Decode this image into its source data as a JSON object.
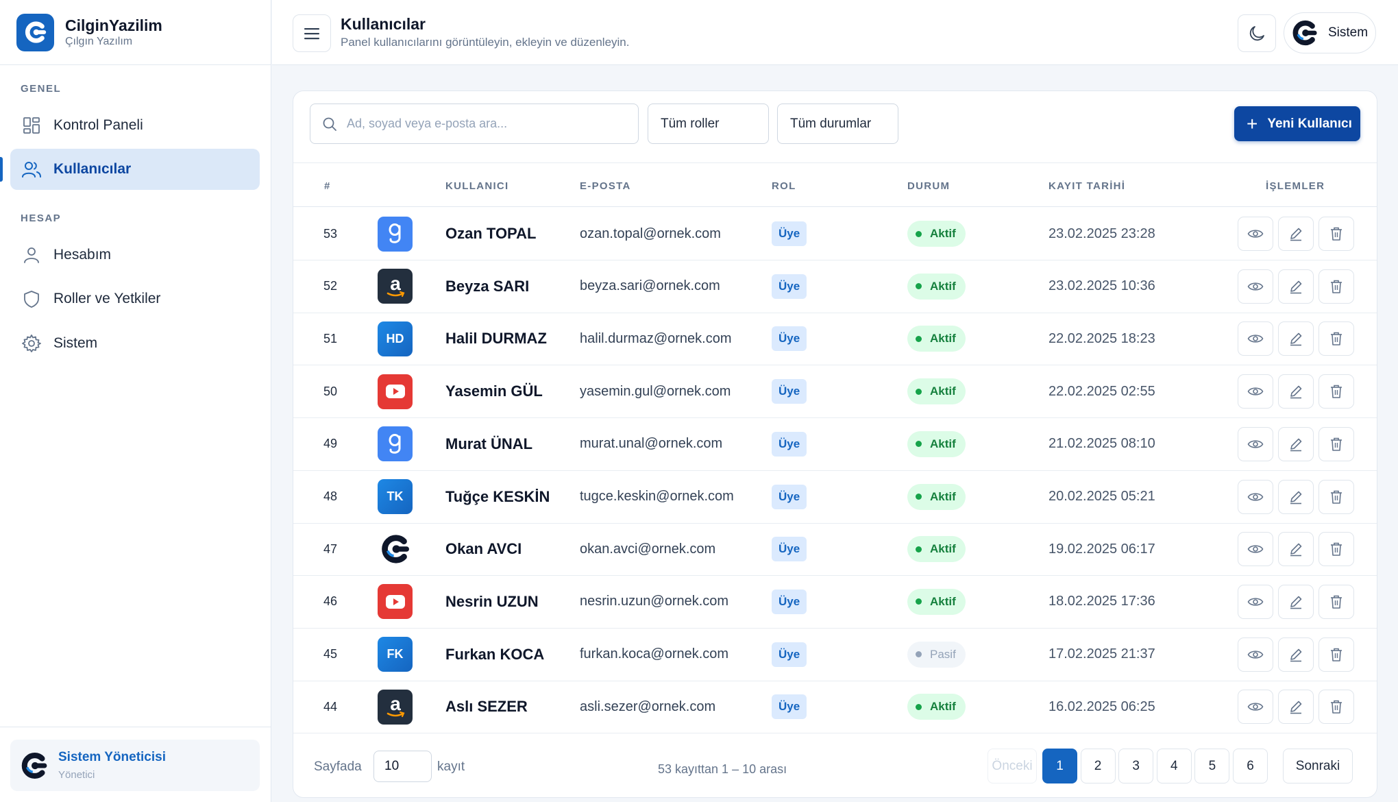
{
  "brand": {
    "name": "CilginYazilim",
    "subtitle": "Çılgın Yazılım"
  },
  "sidebar": {
    "section_general": "GENEL",
    "section_account": "HESAP",
    "items": [
      {
        "label": "Kontrol Paneli",
        "icon": "dashboard-icon",
        "active": false
      },
      {
        "label": "Kullanıcılar",
        "icon": "users-icon",
        "active": true
      },
      {
        "label": "Hesabım",
        "icon": "user-icon",
        "active": false
      },
      {
        "label": "Roller ve Yetkiler",
        "icon": "shield-icon",
        "active": false
      },
      {
        "label": "Sistem",
        "icon": "gear-icon",
        "active": false
      }
    ],
    "footer_user": {
      "name": "Sistem Yöneticisi",
      "role": "Yönetici"
    }
  },
  "header": {
    "title": "Kullanıcılar",
    "subtitle": "Panel kullanıcılarını görüntüleyin, ekleyin ve düzenleyin.",
    "profile_label": "Sistem"
  },
  "toolbar": {
    "search_placeholder": "Ad, soyad veya e-posta ara...",
    "role_filter": "Tüm roller",
    "status_filter": "Tüm durumlar",
    "new_user_label": "Yeni Kullanıcı"
  },
  "table": {
    "columns": [
      "#",
      "KULLANICI",
      "E-POSTA",
      "ROL",
      "DURUM",
      "KAYIT TARİHİ",
      "İŞLEMLER"
    ],
    "rows": [
      {
        "id": "53",
        "avatar": "google",
        "initials": "",
        "name": "Ozan TOPAL",
        "email": "ozan.topal@ornek.com",
        "role": "Üye",
        "status": "Aktif",
        "status_type": "active",
        "date": "23.02.2025 23:28"
      },
      {
        "id": "52",
        "avatar": "amazon",
        "initials": "",
        "name": "Beyza SARI",
        "email": "beyza.sari@ornek.com",
        "role": "Üye",
        "status": "Aktif",
        "status_type": "active",
        "date": "23.02.2025 10:36"
      },
      {
        "id": "51",
        "avatar": "initials",
        "initials": "HD",
        "name": "Halil DURMAZ",
        "email": "halil.durmaz@ornek.com",
        "role": "Üye",
        "status": "Aktif",
        "status_type": "active",
        "date": "22.02.2025 18:23"
      },
      {
        "id": "50",
        "avatar": "youtube",
        "initials": "",
        "name": "Yasemin GÜL",
        "email": "yasemin.gul@ornek.com",
        "role": "Üye",
        "status": "Aktif",
        "status_type": "active",
        "date": "22.02.2025 02:55"
      },
      {
        "id": "49",
        "avatar": "google",
        "initials": "",
        "name": "Murat ÜNAL",
        "email": "murat.unal@ornek.com",
        "role": "Üye",
        "status": "Aktif",
        "status_type": "active",
        "date": "21.02.2025 08:10"
      },
      {
        "id": "48",
        "avatar": "initials",
        "initials": "TK",
        "name": "Tuğçe KESKİN",
        "email": "tugce.keskin@ornek.com",
        "role": "Üye",
        "status": "Aktif",
        "status_type": "active",
        "date": "20.02.2025 05:21"
      },
      {
        "id": "47",
        "avatar": "brand",
        "initials": "",
        "name": "Okan AVCI",
        "email": "okan.avci@ornek.com",
        "role": "Üye",
        "status": "Aktif",
        "status_type": "active",
        "date": "19.02.2025 06:17"
      },
      {
        "id": "46",
        "avatar": "youtube",
        "initials": "",
        "name": "Nesrin UZUN",
        "email": "nesrin.uzun@ornek.com",
        "role": "Üye",
        "status": "Aktif",
        "status_type": "active",
        "date": "18.02.2025 17:36"
      },
      {
        "id": "45",
        "avatar": "initials",
        "initials": "FK",
        "name": "Furkan KOCA",
        "email": "furkan.koca@ornek.com",
        "role": "Üye",
        "status": "Pasif",
        "status_type": "passive",
        "date": "17.02.2025 21:37"
      },
      {
        "id": "44",
        "avatar": "amazon",
        "initials": "",
        "name": "Aslı SEZER",
        "email": "asli.sezer@ornek.com",
        "role": "Üye",
        "status": "Aktif",
        "status_type": "active",
        "date": "16.02.2025 06:25"
      }
    ]
  },
  "footer": {
    "per_page_label": "Sayfada",
    "per_page_value": "10",
    "per_page_suffix": "kayıt",
    "range_info": "53 kayıttan 1 – 10 arası",
    "prev": "Önceki",
    "next": "Sonraki",
    "pages": [
      "1",
      "2",
      "3",
      "4",
      "5",
      "6"
    ],
    "current_page": "1"
  },
  "colors": {
    "accent": "#1565c0",
    "accent_dark": "#0d47a1",
    "active_status": "#15803d",
    "passive_status": "#94a3b8"
  }
}
